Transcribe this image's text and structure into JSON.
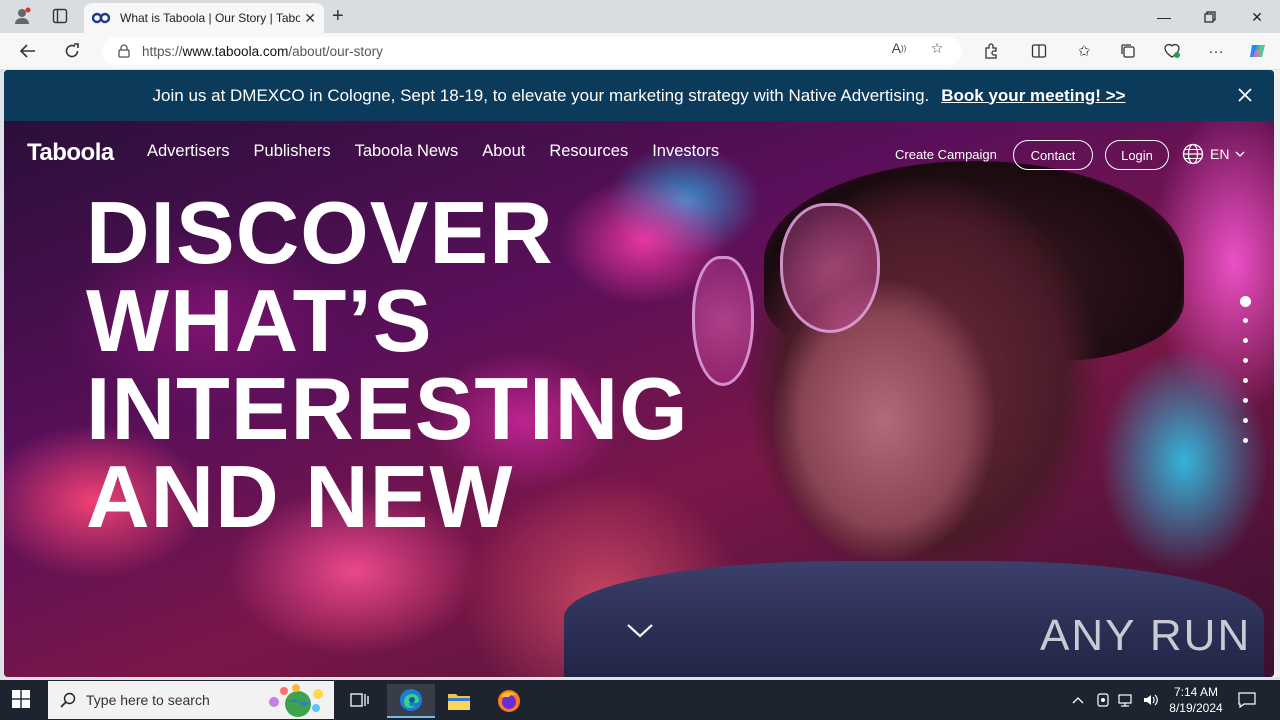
{
  "browser": {
    "tab_title": "What is Taboola | Our Story | Taboola",
    "url_prefix": "https://",
    "url_domain": "www.taboola.com",
    "url_path": "/about/our-story"
  },
  "promo": {
    "text": "Join us at DMEXCO in Cologne, Sept 18-19, to elevate your marketing strategy with Native Advertising.",
    "link": "Book your meeting! >>"
  },
  "nav": {
    "logo": "Taboola",
    "items": [
      "Advertisers",
      "Publishers",
      "Taboola News",
      "About",
      "Resources",
      "Investors"
    ],
    "create_campaign": "Create Campaign",
    "contact": "Contact",
    "login": "Login",
    "lang": "EN"
  },
  "hero": {
    "lines": [
      "DISCOVER",
      "WHAT’S",
      "INTERESTING",
      "AND NEW"
    ],
    "dots_total": 8,
    "dots_active": 1,
    "watermark": "ANY RUN"
  },
  "taskbar": {
    "search_placeholder": "Type here to search",
    "time": "7:14 AM",
    "date": "8/19/2024"
  },
  "colors": {
    "promo_bg": "#0b3a5b",
    "taskbar_bg": "#1d2430",
    "chrome_bg": "#d9dde2"
  }
}
